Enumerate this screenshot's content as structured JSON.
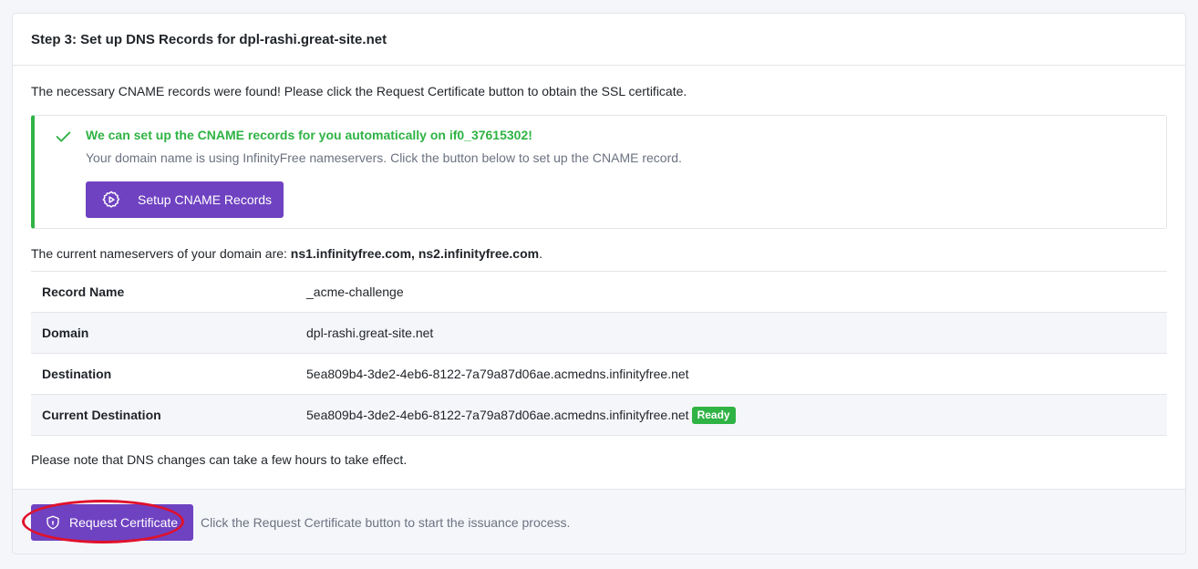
{
  "card": {
    "title": "Step 3: Set up DNS Records for dpl-rashi.great-site.net"
  },
  "intro": "The necessary CNAME records were found! Please click the Request Certificate button to obtain the SSL certificate.",
  "alert": {
    "title": "We can set up the CNAME records for you automatically on if0_37615302!",
    "text": "Your domain name is using InfinityFree nameservers. Click the button below to set up the CNAME record.",
    "button_label": "Setup CNAME Records",
    "icon": "check-icon",
    "button_icon": "gear-play-icon",
    "accent": "#2fb344"
  },
  "nameservers": {
    "prefix": "The current nameservers of your domain are: ",
    "value": "ns1.infinityfree.com, ns2.infinityfree.com",
    "suffix": "."
  },
  "records": [
    {
      "label": "Record Name",
      "value": "_acme-challenge"
    },
    {
      "label": "Domain",
      "value": "dpl-rashi.great-site.net"
    },
    {
      "label": "Destination",
      "value": "5ea809b4-3de2-4eb6-8122-7a79a87d06ae.acmedns.infinityfree.net"
    },
    {
      "label": "Current Destination",
      "value": "5ea809b4-3de2-4eb6-8122-7a79a87d06ae.acmedns.infinityfree.net",
      "badge": "Ready"
    }
  ],
  "note": "Please note that DNS changes can take a few hours to take effect.",
  "footer": {
    "button_label": "Request Certificate",
    "button_icon": "shield-icon",
    "text": "Click the Request Certificate button to start the issuance process."
  },
  "colors": {
    "primary": "#6f42c1",
    "success": "#2fb344",
    "highlight": "#e0112b"
  }
}
